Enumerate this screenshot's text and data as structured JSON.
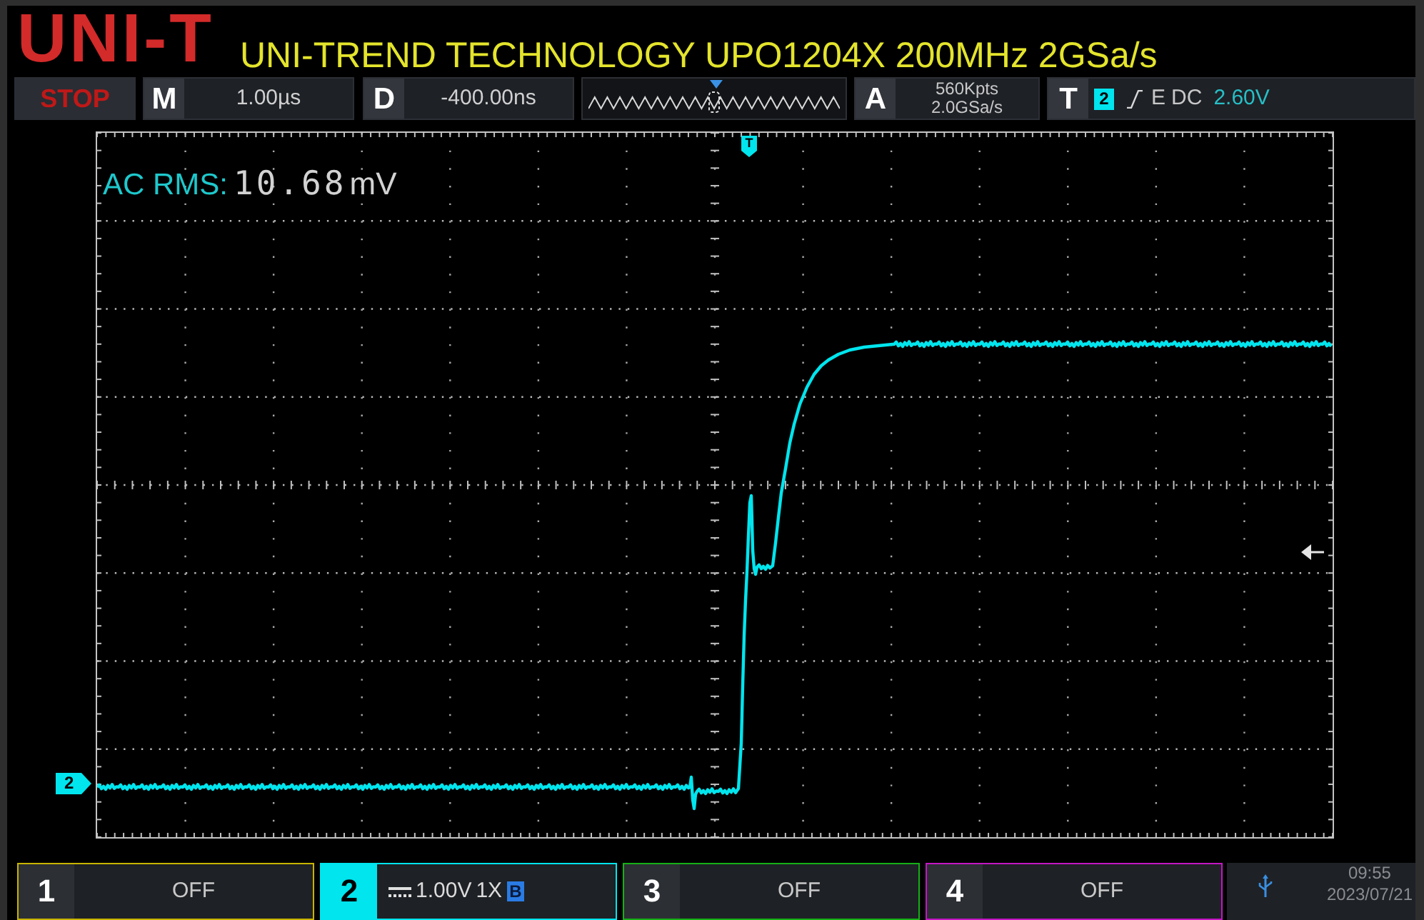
{
  "header": {
    "logo": "UNI-T",
    "title": "UNI-TREND TECHNOLOGY UPO1204X 200MHz 2GSa/s"
  },
  "toolbar": {
    "run_state": "STOP",
    "timebase": {
      "key": "M",
      "value": "1.00µs"
    },
    "delay": {
      "key": "D",
      "value": "-400.00ns"
    },
    "acquire": {
      "key": "A",
      "memory_depth": "560Kpts",
      "sample_rate": "2.0GSa/s"
    },
    "trigger": {
      "key": "T",
      "source": "2",
      "type": "E",
      "coupling": "DC",
      "trigger_level": "2.60V"
    }
  },
  "display": {
    "measurement": {
      "label": "AC RMS:",
      "value": "10.68",
      "unit": "mV"
    },
    "trigger_marker": "T",
    "channel_marker": "2"
  },
  "channels": [
    {
      "kind": "off",
      "number": "1",
      "color": "#c8b400",
      "selected": false,
      "status": "OFF"
    },
    {
      "kind": "on",
      "number": "2",
      "color": "#00e5ee",
      "selected": true,
      "scale": "1.00V",
      "probe": "1X",
      "bandwidth_limit": "B"
    },
    {
      "kind": "off",
      "number": "3",
      "color": "#16b016",
      "selected": false,
      "status": "OFF"
    },
    {
      "kind": "off",
      "number": "4",
      "color": "#c416c4",
      "selected": false,
      "status": "OFF"
    }
  ],
  "status": {
    "time": "09:55",
    "date": "2023/07/21"
  }
}
